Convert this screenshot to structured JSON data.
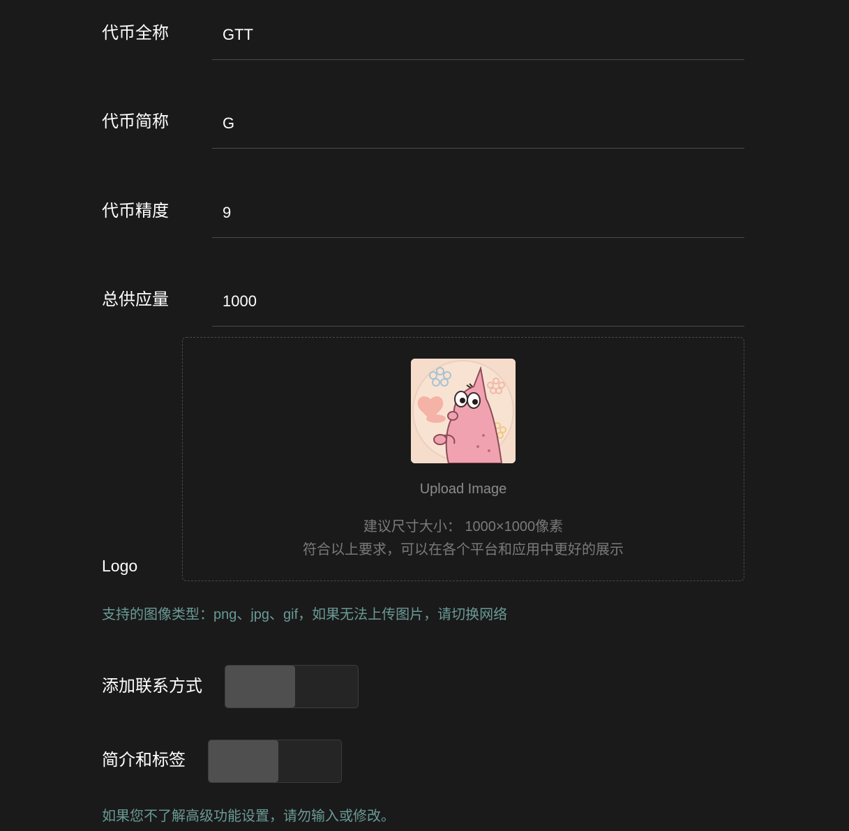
{
  "fields": {
    "full_name": {
      "label": "代币全称",
      "value": "GTT"
    },
    "short_name": {
      "label": "代币简称",
      "value": "G"
    },
    "precision": {
      "label": "代币精度",
      "value": "9"
    },
    "total_supply": {
      "label": "总供应量",
      "value": "1000"
    }
  },
  "logo": {
    "label": "Logo",
    "upload_text": "Upload Image",
    "hint_size": "建议尺寸大小： 1000×1000像素",
    "hint_desc": "符合以上要求，可以在各个平台和应用中更好的展示",
    "image_icon": "patrick-star-avatar"
  },
  "support_note": "支持的图像类型：png、jpg、gif，如果无法上传图片，请切换网络",
  "toggles": {
    "contact": {
      "label": "添加联系方式",
      "state": "off"
    },
    "intro": {
      "label": "简介和标签",
      "state": "off"
    }
  },
  "advanced_note": "如果您不了解高级功能设置，请勿输入或修改。",
  "colors": {
    "background": "#1a1a1a",
    "accent_text": "#6a9a95",
    "border": "#4a4a4a"
  }
}
